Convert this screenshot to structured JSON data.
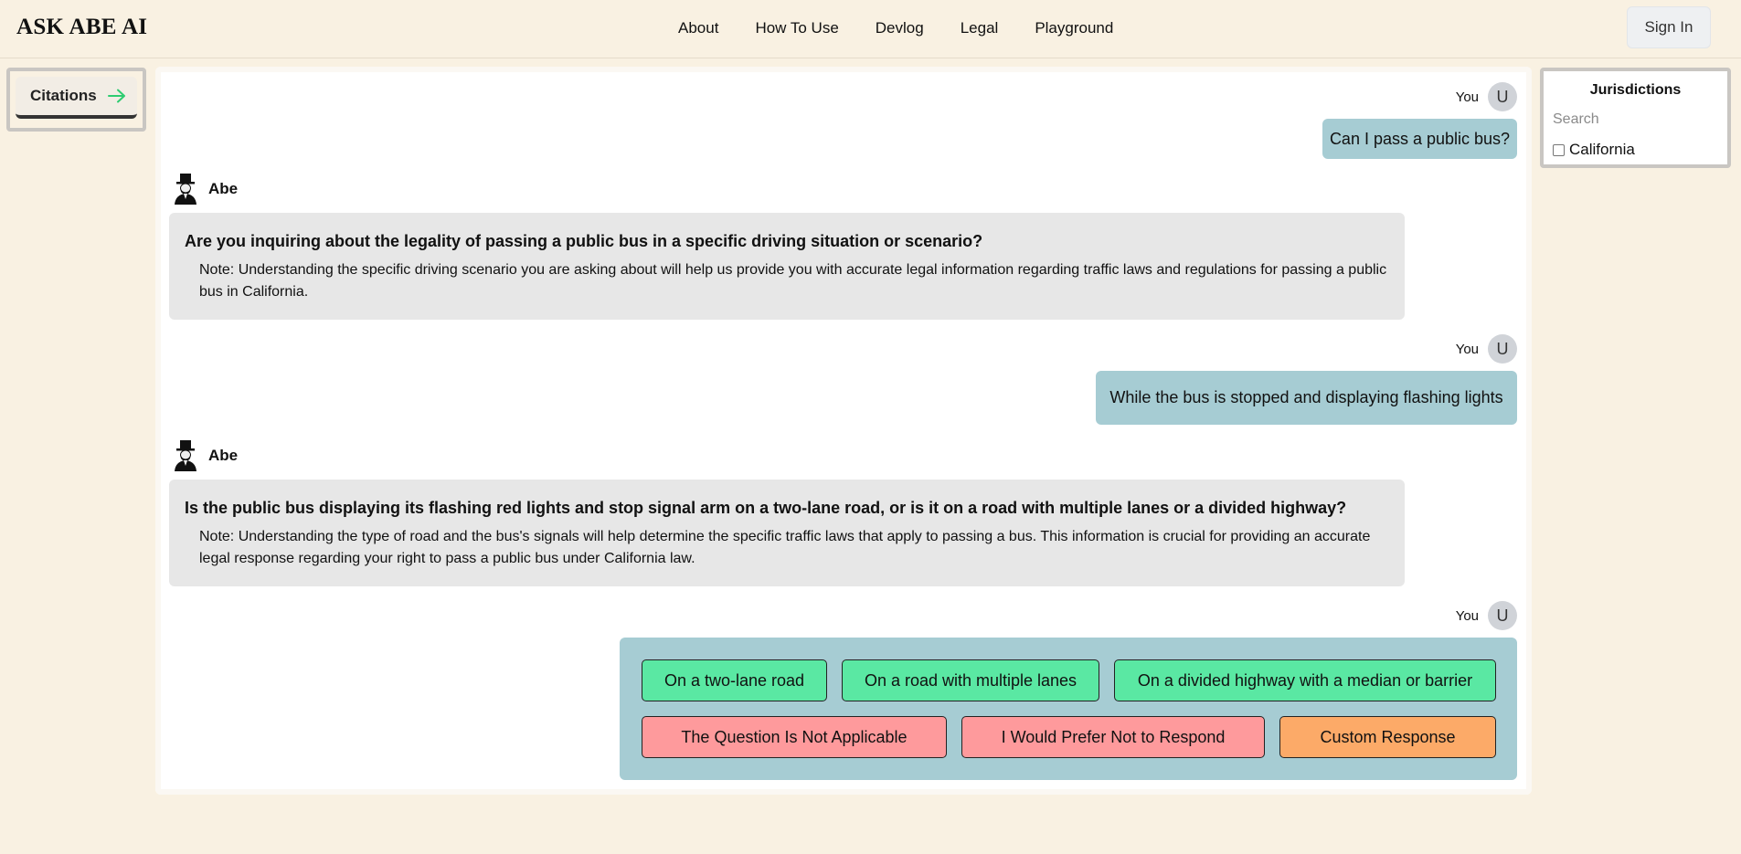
{
  "header": {
    "logo": "ASK ABE AI",
    "nav": [
      "About",
      "How To Use",
      "Devlog",
      "Legal",
      "Playground"
    ],
    "signin_label": "Sign In"
  },
  "citations": {
    "label": "Citations",
    "icon": "arrow-right-icon",
    "icon_color": "#2ecc71"
  },
  "jurisdictions": {
    "title": "Jurisdictions",
    "search_placeholder": "Search",
    "options": [
      {
        "label": "California",
        "checked": false
      }
    ]
  },
  "chat": {
    "user_label": "You",
    "user_initial": "U",
    "assistant_name": "Abe",
    "messages": [
      {
        "role": "user",
        "text": "Can I pass a public bus?"
      },
      {
        "role": "assistant",
        "question": "Are you inquiring about the legality of passing a public bus in a specific driving situation or scenario?",
        "note": "Note: Understanding the specific driving scenario you are asking about will help us provide you with accurate legal information regarding traffic laws and regulations for passing a public bus in California."
      },
      {
        "role": "user",
        "text": "While the bus is stopped and displaying flashing lights"
      },
      {
        "role": "assistant",
        "question": "Is the public bus displaying its flashing red lights and stop signal arm on a two-lane road, or is it on a road with multiple lanes or a divided highway?",
        "note": "Note: Understanding the type of road and the bus's signals will help determine the specific traffic laws that apply to passing a bus. This information is crucial for providing an accurate legal response regarding your right to pass a public bus under California law."
      }
    ],
    "choices": [
      {
        "label": "On a two-lane road",
        "kind": "option"
      },
      {
        "label": "On a road with multiple lanes",
        "kind": "option"
      },
      {
        "label": "On a divided highway with a median or barrier",
        "kind": "option"
      },
      {
        "label": "The Question Is Not Applicable",
        "kind": "decline"
      },
      {
        "label": "I Would Prefer Not to Respond",
        "kind": "decline"
      },
      {
        "label": "Custom Response",
        "kind": "custom"
      }
    ]
  },
  "colors": {
    "page_bg": "#f9f1e2",
    "user_bubble": "#a6ccd3",
    "assistant_bubble": "#e7e7e7",
    "option_green": "#5ae8a3",
    "decline_red": "#fe9a9c",
    "custom_orange": "#fcaa68"
  }
}
